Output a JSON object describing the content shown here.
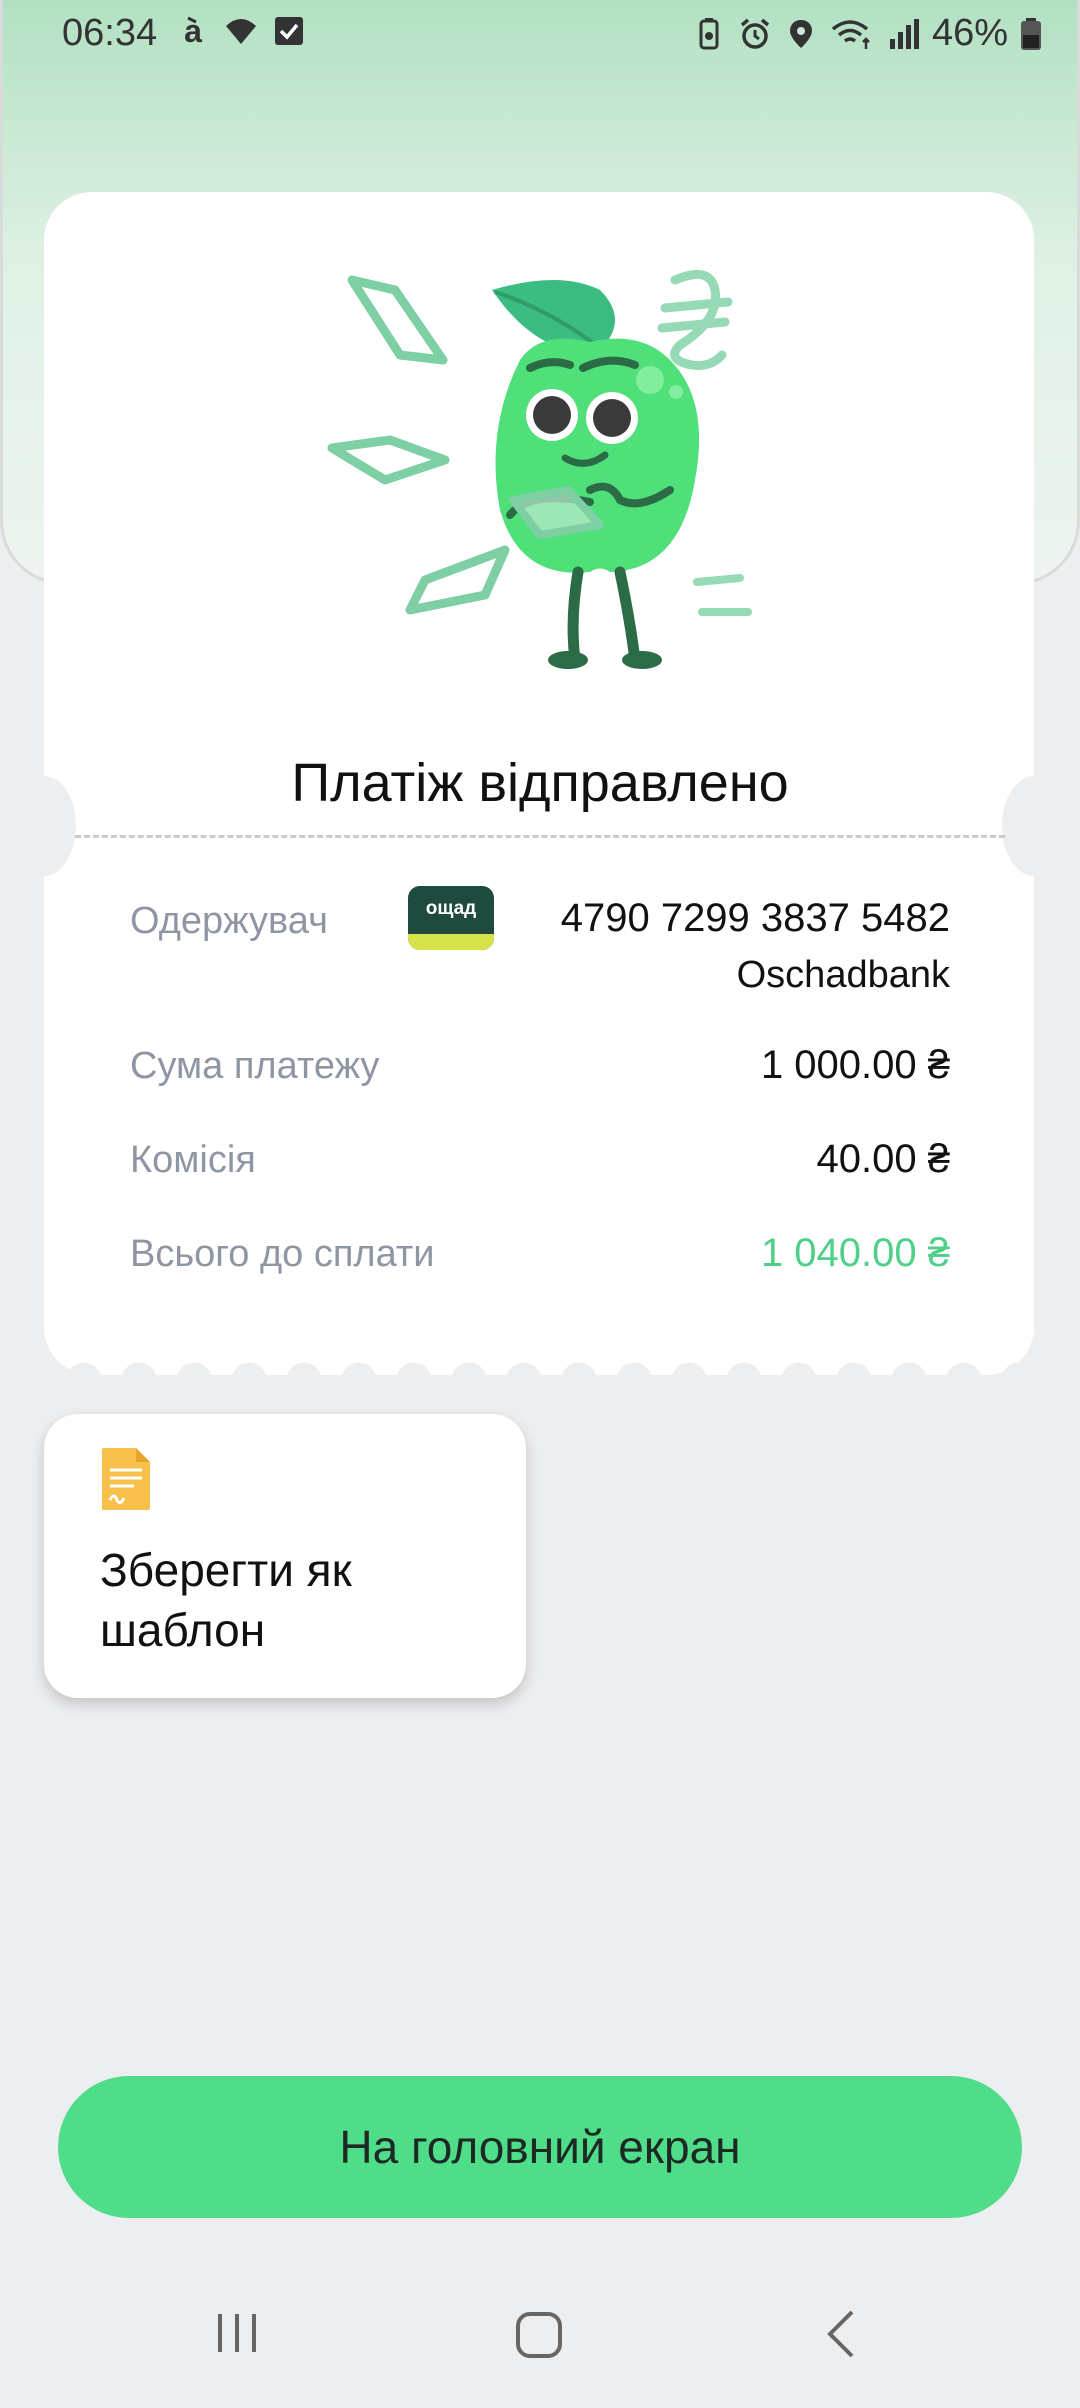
{
  "status_bar": {
    "time": "06:34",
    "battery": "46%",
    "icons_left": [
      "a-app-icon",
      "wifi-icon",
      "checkbox-icon"
    ],
    "icons_right": [
      "battery-saver-icon",
      "alarm-icon",
      "location-icon",
      "wifi-calling-icon",
      "signal-icon",
      "battery-icon"
    ]
  },
  "receipt": {
    "title": "Платіж відправлено",
    "recipient_label": "Одержувач",
    "bank_logo_text": "ощад",
    "card_number": "4790 7299 3837 5482",
    "bank_name": "Oschadbank",
    "amount_label": "Сума платежу",
    "amount_value": "1 000.00 ₴",
    "fee_label": "Комісія",
    "fee_value": "40.00 ₴",
    "total_label": "Всього до сплати",
    "total_value": "1 040.00 ₴"
  },
  "save_template": {
    "label": "Зберегти як шаблон",
    "icon": "document-icon"
  },
  "main_button": {
    "label": "На головний екран"
  },
  "nav_bar": {
    "items": [
      "recent-apps-icon",
      "home-icon",
      "back-icon"
    ]
  },
  "colors": {
    "accent": "#4fdd8a",
    "total": "#4fcf88",
    "background": "#eceef0"
  }
}
